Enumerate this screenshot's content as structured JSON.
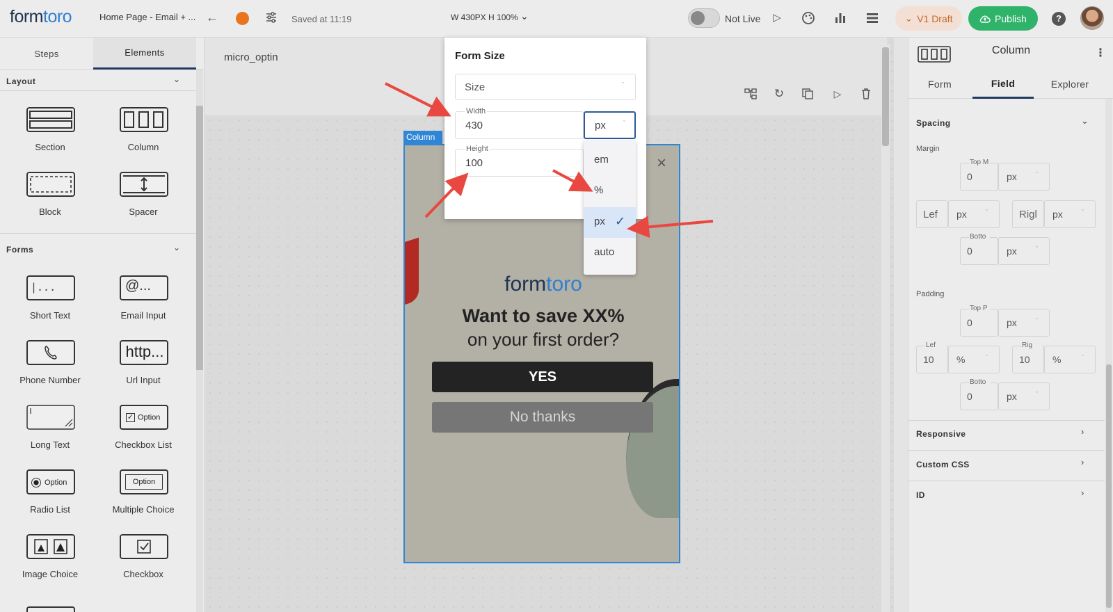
{
  "app": {
    "logo_part1": "form",
    "logo_part2": "toro",
    "page_title": "Home Page - Email + ...",
    "saved_text": "Saved at 11:19",
    "size_summary": "W 430PX  H 100%",
    "live_status": "Not Live",
    "draft_label": "V1 Draft",
    "publish_label": "Publish",
    "help_label": "?",
    "accent_color": "#2f86d6",
    "publish_color": "#2fb26a",
    "status_dot_color": "#e8741e"
  },
  "left": {
    "tabs": [
      "Steps",
      "Elements"
    ],
    "active_tab": "Elements",
    "layout_header": "Layout",
    "forms_header": "Forms",
    "layout_items": [
      "Section",
      "Column",
      "Block",
      "Spacer"
    ],
    "form_items": [
      "Short Text",
      "Email Input",
      "Phone Number",
      "Url Input",
      "Long Text",
      "Checkbox List",
      "Radio List",
      "Multiple Choice",
      "Image Choice",
      "Checkbox"
    ],
    "icon_texts": {
      "short_text": "|...",
      "email": "@...",
      "url": "http...",
      "option": "Option"
    }
  },
  "canvas": {
    "form_name": "micro_optin",
    "column_tag": "Column"
  },
  "popup": {
    "logo_part1": "form",
    "logo_part2": "toro",
    "headline": "Want to save XX%",
    "subline": "on your first order?",
    "yes_label": "YES",
    "no_label": "No thanks",
    "close": "×"
  },
  "form_size": {
    "title": "Form Size",
    "size_select": "Size",
    "width_label": "Width",
    "width_value": "430",
    "height_label": "Height",
    "height_value": "100",
    "unit_value": "px",
    "unit_options": [
      "em",
      "%",
      "px",
      "auto"
    ],
    "selected_unit": "px"
  },
  "right": {
    "title": "Column",
    "tabs": [
      "Form",
      "Field",
      "Explorer"
    ],
    "active_tab": "Field",
    "spacing_header": "Spacing",
    "margin_label": "Margin",
    "padding_label": "Padding",
    "margin": {
      "top_label": "Top M",
      "top_value": "0",
      "top_unit": "px",
      "left_text": "Lef",
      "left_unit": "px",
      "right_text": "Rigl",
      "right_unit": "px",
      "bottom_label": "Botto",
      "bottom_value": "0",
      "bottom_unit": "px"
    },
    "padding": {
      "top_label": "Top P",
      "top_value": "0",
      "top_unit": "px",
      "left_label": "Lef",
      "left_value": "10",
      "left_unit": "%",
      "right_label": "Rig",
      "right_value": "10",
      "right_unit": "%",
      "bottom_label": "Botto",
      "bottom_value": "0",
      "bottom_unit": "px"
    },
    "collapsed_sections": [
      "Responsive",
      "Custom CSS",
      "ID"
    ]
  }
}
